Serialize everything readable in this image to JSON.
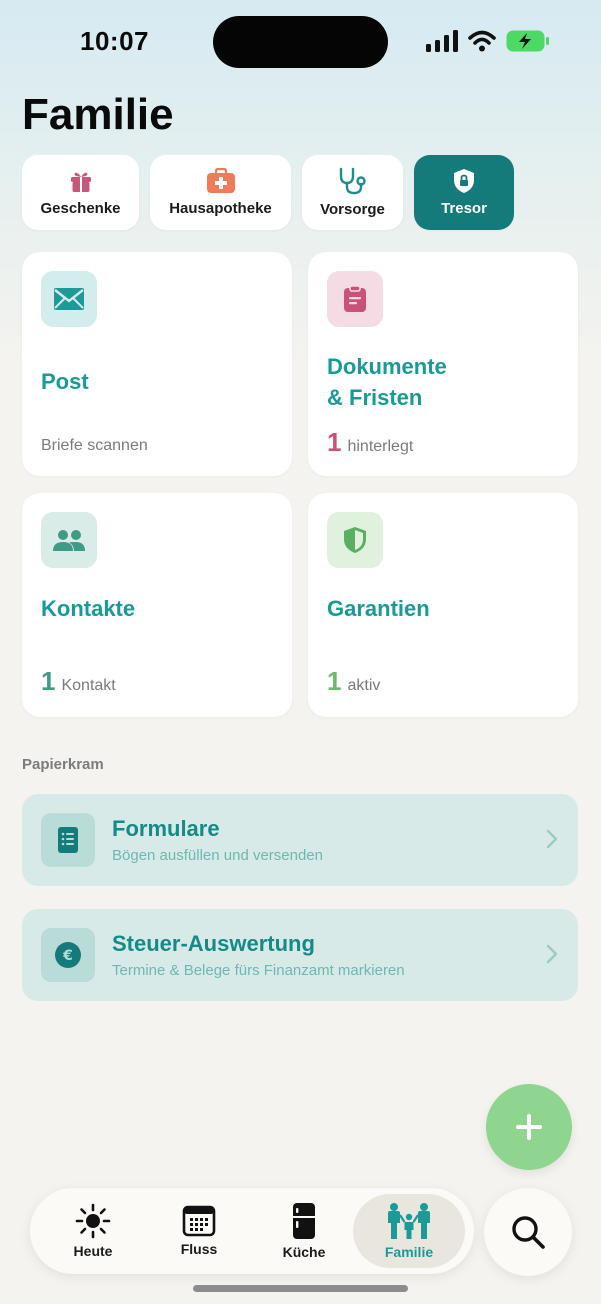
{
  "status_bar": {
    "time": "10:07"
  },
  "page": {
    "title": "Familie"
  },
  "chips": [
    {
      "label": "Geschenke",
      "icon": "gift-icon",
      "color": "#c8587a"
    },
    {
      "label": "Hausapotheke",
      "icon": "first-aid-kit-icon",
      "color": "#ee7c5b"
    },
    {
      "label": "Vorsorge",
      "icon": "stethoscope-icon",
      "color": "#1a8f8d"
    },
    {
      "label": "Tresor",
      "icon": "shield-lock-icon",
      "color": "#ffffff",
      "active": true
    }
  ],
  "cards": {
    "post": {
      "title": "Post",
      "subtitle": "Briefe scannen",
      "icon": "envelope-icon"
    },
    "dokumente": {
      "title_line1": "Dokumente",
      "title_line2": "& Fristen",
      "count": "1",
      "count_label": "hinterlegt",
      "icon": "clipboard-icon",
      "count_color": "#c9527a"
    },
    "kontakte": {
      "title": "Kontakte",
      "count": "1",
      "count_label": "Kontakt",
      "icon": "people-icon",
      "count_color": "#3f9a86"
    },
    "garantien": {
      "title": "Garantien",
      "count": "1",
      "count_label": "aktiv",
      "icon": "shield-icon",
      "count_color": "#6cbb6c"
    }
  },
  "section": {
    "label": "Papierkram"
  },
  "rows": [
    {
      "title": "Formulare",
      "subtitle": "Bögen ausfüllen und versenden",
      "icon": "form-icon"
    },
    {
      "title": "Steuer-Auswertung",
      "subtitle": "Termine & Belege fürs Finanzamt markieren",
      "icon": "euro-icon"
    }
  ],
  "fab": {
    "icon": "plus-icon"
  },
  "tabs": [
    {
      "label": "Heute",
      "icon": "sun-icon"
    },
    {
      "label": "Fluss",
      "icon": "calendar-icon"
    },
    {
      "label": "Küche",
      "icon": "fridge-icon"
    },
    {
      "label": "Familie",
      "icon": "family-icon",
      "active": true
    }
  ],
  "search": {
    "icon": "search-icon"
  },
  "colors": {
    "accent": "#147a7a",
    "teal_text": "#189a98",
    "fab": "#8fd48f"
  }
}
